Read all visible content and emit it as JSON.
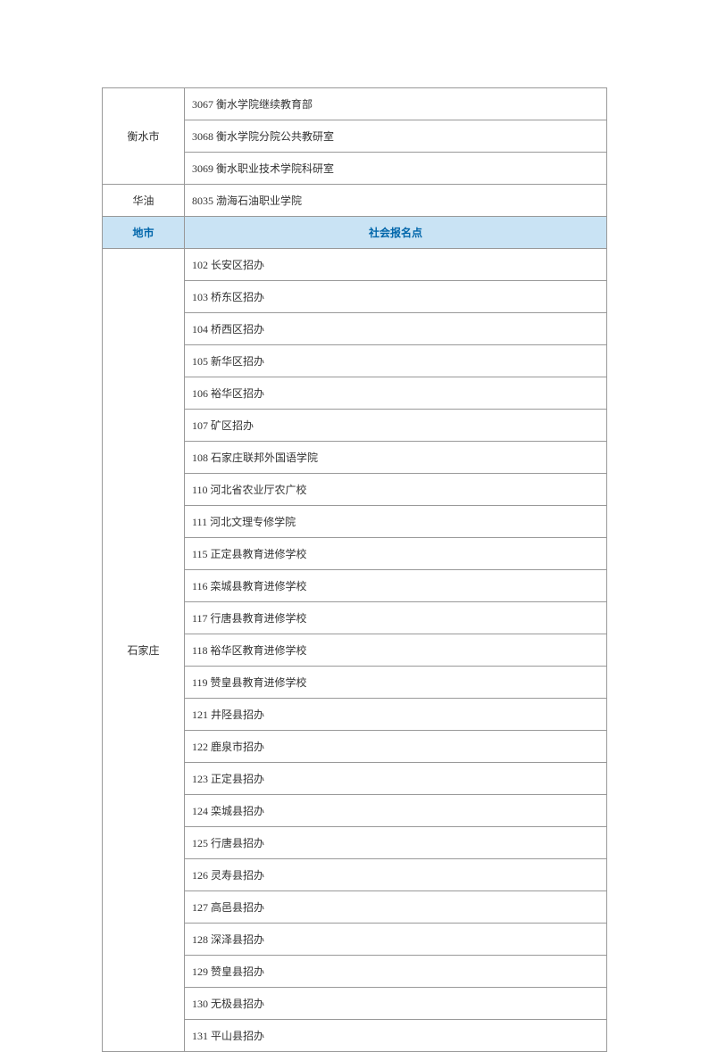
{
  "sections": [
    {
      "city": "衡水市",
      "items": [
        "3067 衡水学院继续教育部",
        "3068 衡水学院分院公共教研室",
        "3069 衡水职业技术学院科研室"
      ]
    },
    {
      "city": "华油",
      "items": [
        "8035 渤海石油职业学院"
      ]
    }
  ],
  "headerCity": "地市",
  "headerContent": "社会报名点",
  "section2": {
    "city": "石家庄",
    "items": [
      "102 长安区招办",
      "103 桥东区招办",
      "104 桥西区招办",
      "105 新华区招办",
      "106 裕华区招办",
      "107 矿区招办",
      "108 石家庄联邦外国语学院",
      "110 河北省农业厅农广校",
      "111 河北文理专修学院",
      "115 正定县教育进修学校",
      "116 栾城县教育进修学校",
      "117 行唐县教育进修学校",
      "118 裕华区教育进修学校",
      "119 赞皇县教育进修学校",
      "121 井陉县招办",
      "122 鹿泉市招办",
      "123 正定县招办",
      "124 栾城县招办",
      "125 行唐县招办",
      "126 灵寿县招办",
      "127 高邑县招办",
      "128 深泽县招办",
      "129 赞皇县招办",
      "130 无极县招办",
      "131 平山县招办"
    ]
  }
}
